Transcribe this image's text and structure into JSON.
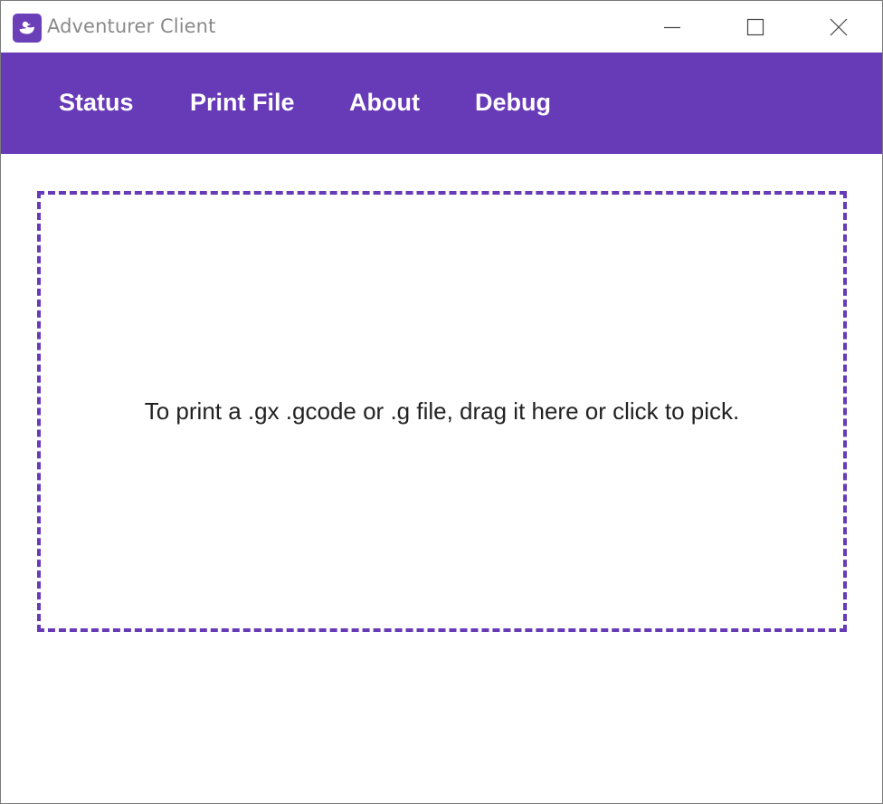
{
  "window": {
    "title": "Adventurer Client",
    "icon": "duck-icon",
    "controls": {
      "minimize_icon": "minimize-icon",
      "maximize_icon": "maximize-icon",
      "close_icon": "close-icon"
    }
  },
  "nav": {
    "items": [
      {
        "label": "Status"
      },
      {
        "label": "Print File"
      },
      {
        "label": "About"
      },
      {
        "label": "Debug"
      }
    ]
  },
  "dropzone": {
    "text": "To print a .gx .gcode or .g file, drag it here or click to pick."
  },
  "colors": {
    "accent": "#673ab7",
    "nav_text": "#ffffff",
    "title_text": "#8a8a8a",
    "body_text": "#222222"
  }
}
